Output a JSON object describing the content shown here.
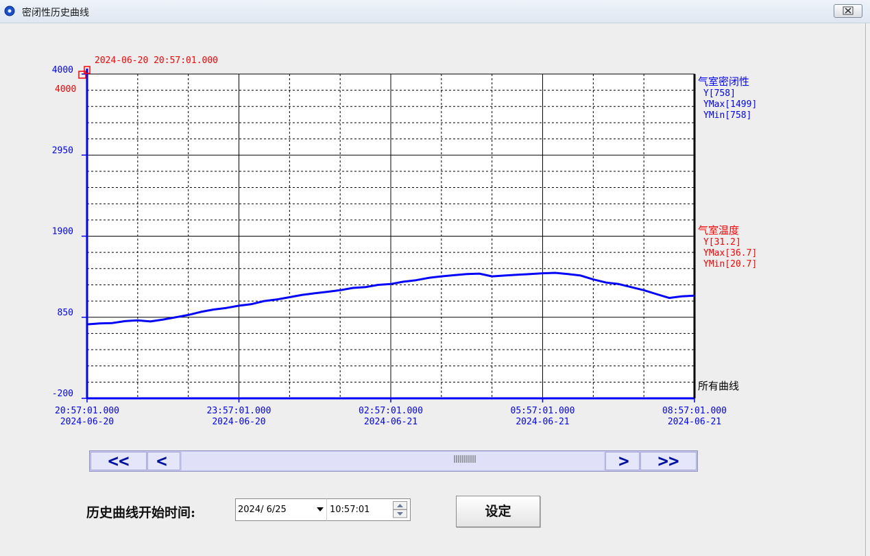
{
  "window": {
    "title": "密闭性历史曲线",
    "close_symbol": "✕"
  },
  "chart": {
    "cursor_time": "2024-06-20 20:57:01.000",
    "cursor_value": "4000",
    "series_group_label": "所有曲线",
    "colors": {
      "series1": "#0000ff",
      "series2": "#ff0000",
      "grid": "#000000"
    },
    "series_legends": [
      {
        "name": "气室密闭性",
        "y": "Y[758]",
        "ymax": "YMax[1499]",
        "ymin": "YMin[758]",
        "color": "#0000ff"
      },
      {
        "name": "气室温度",
        "y": "Y[31.2]",
        "ymax": "YMax[36.7]",
        "ymin": "YMin[20.7]",
        "color": "#ff0000"
      }
    ]
  },
  "chart_data": {
    "type": "line",
    "ylim": [
      -200,
      4000
    ],
    "y_ticks": [
      "4000",
      "2950",
      "1900",
      "850",
      "-200"
    ],
    "x_ticks": [
      {
        "time": "20:57:01.000",
        "date": "2024-06-20"
      },
      {
        "time": "23:57:01.000",
        "date": "2024-06-20"
      },
      {
        "time": "02:57:01.000",
        "date": "2024-06-21"
      },
      {
        "time": "05:57:01.000",
        "date": "2024-06-21"
      },
      {
        "time": "08:57:01.000",
        "date": "2024-06-21"
      }
    ],
    "x_range_hours": [
      0,
      12
    ],
    "series": [
      {
        "name": "气室密闭性",
        "x_hours": [
          0,
          0.25,
          0.5,
          0.75,
          1,
          1.25,
          1.5,
          1.75,
          2,
          2.25,
          2.5,
          2.75,
          3,
          3.25,
          3.5,
          3.75,
          4,
          4.25,
          4.5,
          4.75,
          5,
          5.25,
          5.5,
          5.75,
          6,
          6.25,
          6.5,
          6.75,
          7,
          7.25,
          7.5,
          7.75,
          8,
          8.25,
          8.5,
          8.75,
          9,
          9.25,
          9.5,
          9.75,
          10,
          10.25,
          10.5,
          10.75,
          11,
          11.25,
          11.5,
          11.75,
          12
        ],
        "values": [
          758,
          770,
          775,
          800,
          810,
          795,
          820,
          850,
          880,
          920,
          950,
          970,
          1000,
          1020,
          1060,
          1080,
          1110,
          1140,
          1160,
          1180,
          1200,
          1230,
          1240,
          1270,
          1280,
          1310,
          1330,
          1360,
          1380,
          1395,
          1410,
          1415,
          1380,
          1390,
          1400,
          1410,
          1420,
          1425,
          1410,
          1390,
          1340,
          1300,
          1280,
          1240,
          1200,
          1150,
          1100,
          1120,
          1130
        ]
      }
    ]
  },
  "scrollbar": {
    "fast_back": "<<",
    "back": "<",
    "forward": ">",
    "fast_forward": ">>"
  },
  "controls": {
    "start_time_label": "历史曲线开始时间:",
    "date_value": "2024/ 6/25",
    "time_value": "10:57:01",
    "set_label": "设定"
  }
}
